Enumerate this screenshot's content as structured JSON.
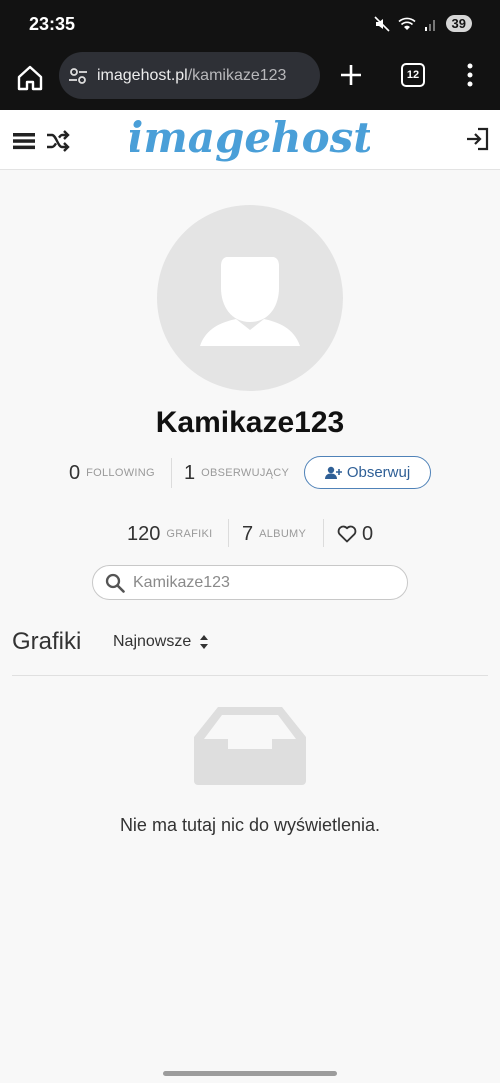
{
  "status_bar": {
    "time": "23:35",
    "battery": "39"
  },
  "browser": {
    "url_domain": "imagehost.pl",
    "url_path": "/kamikaze123",
    "tab_count": "12",
    "icons": {
      "home": "home-icon",
      "site_info": "tune-icon",
      "new_tab": "plus-icon",
      "menu": "more-vert-icon"
    }
  },
  "site": {
    "logo_text": "imagehost",
    "brand_color": "#4a9fd8",
    "icons": {
      "menu": "hamburger-icon",
      "random": "shuffle-icon",
      "login": "login-icon"
    }
  },
  "profile": {
    "username": "Kamikaze123",
    "following_count": "0",
    "following_label": "FOLLOWING",
    "followers_count": "1",
    "followers_label": "OBSERWUJĄCY",
    "follow_button": "Obserwuj",
    "images_count": "120",
    "images_label": "GRAFIKI",
    "albums_count": "7",
    "albums_label": "ALBUMY",
    "likes_count": "0"
  },
  "search": {
    "placeholder": "Kamikaze123"
  },
  "content": {
    "section_title": "Grafiki",
    "sort_label": "Najnowsze",
    "empty_message": "Nie ma tutaj nic do wyświetlenia."
  }
}
